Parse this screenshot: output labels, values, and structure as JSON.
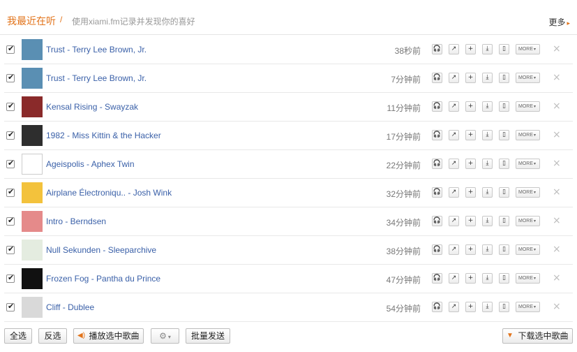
{
  "header": {
    "title": "我最近在听",
    "separator": "/",
    "subtitle": "使用xiami.fm记录并发现你的喜好",
    "more_label": "更多",
    "more_arrow": "▸"
  },
  "row_actions": {
    "listen": "🎧",
    "share": "↗",
    "add": "+",
    "download": "⤓",
    "device": "▯",
    "more_label": "MORE",
    "more_arrow": "▾",
    "delete": "×"
  },
  "songs": [
    {
      "title": "Trust - Terry Lee Brown, Jr.",
      "time": "38秒前",
      "cover_color": "#5a8fb3",
      "checked": true
    },
    {
      "title": "Trust - Terry Lee Brown, Jr.",
      "time": "7分钟前",
      "cover_color": "#5a8fb3",
      "checked": true
    },
    {
      "title": "Kensal Rising - Swayzak",
      "time": "11分钟前",
      "cover_color": "#8a2a2a",
      "checked": true
    },
    {
      "title": "1982 - Miss Kittin & the Hacker",
      "time": "17分钟前",
      "cover_color": "#2e2e2e",
      "checked": true
    },
    {
      "title": "Ageispolis - Aphex Twin",
      "time": "22分钟前",
      "cover_color": "#ffffff",
      "checked": true
    },
    {
      "title": "Airplane Électroniqu.. - Josh Wink",
      "time": "32分钟前",
      "cover_color": "#f3c23c",
      "checked": true
    },
    {
      "title": "Intro - Berndsen",
      "time": "34分钟前",
      "cover_color": "#e58a8a",
      "checked": true
    },
    {
      "title": "Null Sekunden - Sleeparchive",
      "time": "38分钟前",
      "cover_color": "#e4ece0",
      "checked": true
    },
    {
      "title": "Frozen Fog - Pantha du Prince",
      "time": "47分钟前",
      "cover_color": "#111111",
      "checked": true
    },
    {
      "title": "Cliff - Dublee",
      "time": "54分钟前",
      "cover_color": "#d9d9d9",
      "checked": true
    }
  ],
  "footer": {
    "select_all": "全选",
    "invert": "反选",
    "play_selected": "播放选中歌曲",
    "gear_icon": "⚙",
    "gear_arrow": "▾",
    "batch_send": "批量发送",
    "download_selected": "下载选中歌曲"
  },
  "colors": {
    "accent": "#e2731a",
    "link": "#3a60a8"
  }
}
